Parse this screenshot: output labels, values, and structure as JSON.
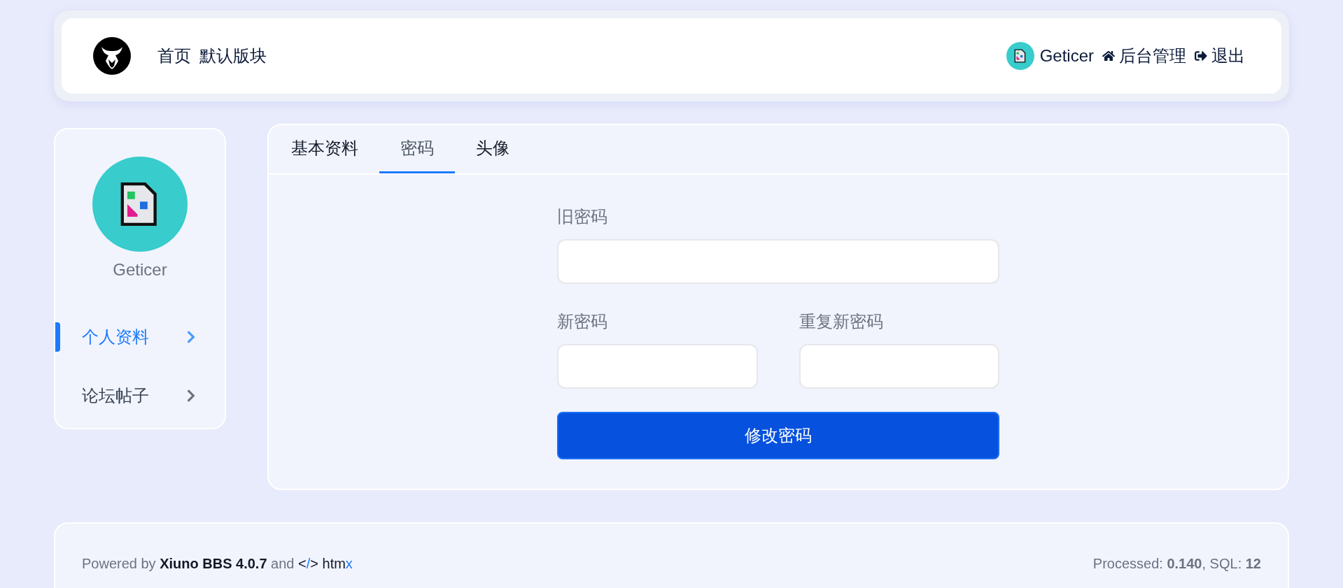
{
  "header": {
    "nav": [
      "首页",
      "默认版块"
    ],
    "user": {
      "name": "Geticer"
    },
    "links": [
      {
        "kind": "home",
        "label": "后台管理"
      },
      {
        "kind": "logout",
        "label": "退出"
      }
    ]
  },
  "sidebar": {
    "username": "Geticer",
    "items": [
      {
        "label": "个人资料",
        "selected": true
      },
      {
        "label": "论坛帖子",
        "selected": false
      }
    ]
  },
  "tabs": [
    {
      "label": "基本资料",
      "selected": false
    },
    {
      "label": "密码",
      "selected": true
    },
    {
      "label": "头像",
      "selected": false
    }
  ],
  "form": {
    "old_password": {
      "label": "旧密码"
    },
    "new_password": {
      "label": "新密码"
    },
    "repeat_password": {
      "label": "重复新密码"
    },
    "submit": "修改密码"
  },
  "footer": {
    "credit": [
      {
        "kind": "muted",
        "text": "Powered by "
      },
      {
        "kind": "strong",
        "text": "Xiuno BBS 4.0.7"
      },
      {
        "kind": "muted",
        "text": " and "
      },
      {
        "kind": "dark",
        "text": "<"
      },
      {
        "kind": "accent",
        "text": "/"
      },
      {
        "kind": "dark",
        "text": "> htm"
      },
      {
        "kind": "accent",
        "text": "x"
      }
    ],
    "stats": "Processed: **0.140**, SQL: **12**"
  }
}
